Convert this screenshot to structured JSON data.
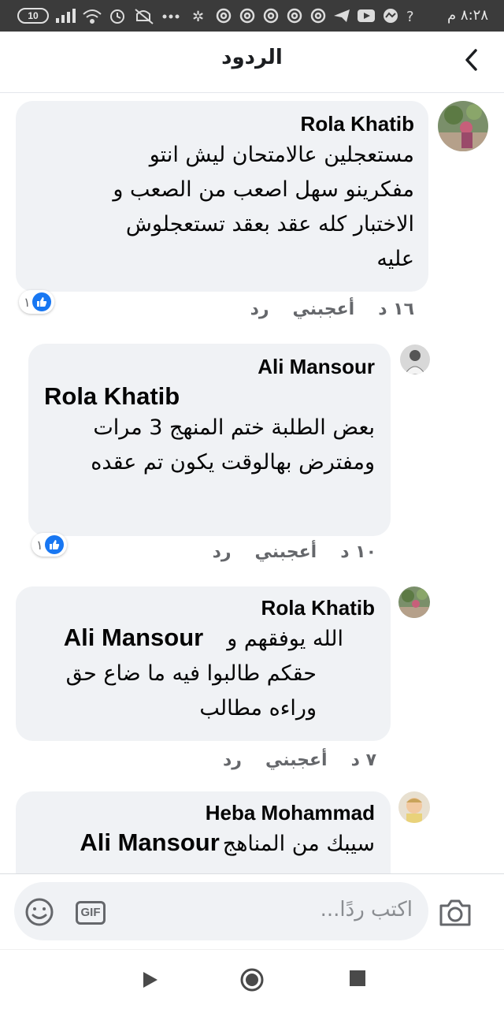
{
  "status_bar": {
    "time": "٨:٢٨ م",
    "battery": "10",
    "icons": [
      "signal-icon",
      "wifi-icon",
      "alarm-icon",
      "mute-icon",
      "more-icon",
      "app-icon",
      "chrome-icon",
      "telegram-icon",
      "youtube-icon",
      "messenger-icon",
      "question-icon"
    ]
  },
  "header": {
    "title": "الردود",
    "back_icon": "chevron-left-icon"
  },
  "comments": [
    {
      "author": "Rola Khatib",
      "lines": [
        "مستعجلين عالامتحان ليش انتو",
        "مفكرينو سهل اصعب من الصعب و",
        "الاختبار كله عقد بعقد تستعجلوش",
        "عليه"
      ],
      "time": "١٦ د",
      "like": "أعجبني",
      "reply": "رد",
      "reactions": "١"
    },
    {
      "author": "Ali Mansour",
      "mention": "Rola Khatib",
      "lines": [
        "بعض الطلبة ختم المنهج 3 مرات",
        "ومفترض بهالوقت يكون تم عقده"
      ],
      "time": "١٠ د",
      "like": "أعجبني",
      "reply": "رد",
      "reactions": "١"
    },
    {
      "author": "Rola Khatib",
      "line1_text": "الله يوفقهم و",
      "mention": "Ali Mansour",
      "lines": [
        "حقكم طالبوا فيه  ما ضاع حق",
        "وراءه مطالب"
      ],
      "time": "٧ د",
      "like": "أعجبني",
      "reply": "رد"
    },
    {
      "author": "Heba Mohammad",
      "line1_text": "سيبك من المناهج",
      "mention": "Ali Mansour"
    }
  ],
  "composer": {
    "placeholder": "اكتب ردًا...",
    "gif_label": "GIF"
  },
  "navbar": {
    "icons": [
      "back-triangle-icon",
      "home-circle-icon",
      "recents-square-icon"
    ]
  },
  "colors": {
    "bubble": "#f0f2f5",
    "like_blue": "#1877f2",
    "meta_gray": "#65676b"
  }
}
